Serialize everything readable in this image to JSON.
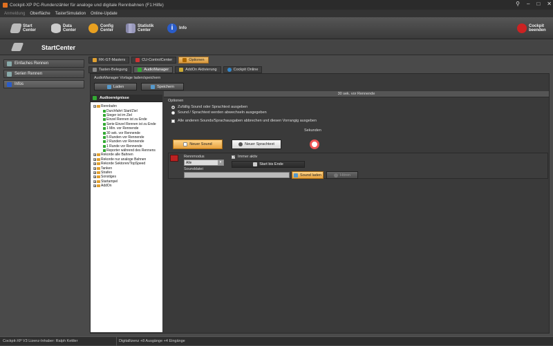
{
  "window": {
    "title": "Cockpit-XP PC-Rundenzähler für analoge und digitale Rennbahnen (F1:Hilfe)"
  },
  "menu": [
    {
      "label": "Anmeldung",
      "disabled": true
    },
    {
      "label": "Oberfläche"
    },
    {
      "label": "TasterSimulation"
    },
    {
      "label": "Online-Update"
    }
  ],
  "toolbar": {
    "start": "Start\nCenter",
    "data": "Data\nCenter",
    "config": "Config\nCenter",
    "stats": "Statistik\nCenter",
    "info": "Info",
    "exit": "Cockpit\nbeenden"
  },
  "header": {
    "title": "StartCenter"
  },
  "sidebar": [
    "Einfaches Rennen",
    "Serien Rennen",
    "Infos"
  ],
  "tabs_top": [
    "RK-GT-Masters",
    "CU-ControlCenter",
    "Optionen"
  ],
  "tabs_sub": [
    "Tasten-Belegung",
    "AudioManager",
    "AddOn Aktivierung",
    "Cockpit Online"
  ],
  "template": {
    "label": "AudioManager Vorlage laden/speichern",
    "load": "Laden",
    "save": "Speichern"
  },
  "selected_item": "30 sek. vor Rennende",
  "tree": {
    "header": "Audioereignisse",
    "items": [
      {
        "label": "Rennbahn",
        "level": 0,
        "type": "folder",
        "exp": "⊟"
      },
      {
        "label": "Durchfahrt Start/Ziel",
        "level": 1,
        "type": "leaf"
      },
      {
        "label": "Sieger ist im Ziel",
        "level": 1,
        "type": "leaf"
      },
      {
        "label": "Einzel Rennen ist zu Ende",
        "level": 1,
        "type": "leaf"
      },
      {
        "label": "Serie Einzel Rennen ist zu Ende",
        "level": 1,
        "type": "leaf"
      },
      {
        "label": "1 Min. vor Rennende",
        "level": 1,
        "type": "leaf"
      },
      {
        "label": "30 sek. vor Rennende",
        "level": 1,
        "type": "leaf"
      },
      {
        "label": "5 Runden vor Rennende",
        "level": 1,
        "type": "leaf"
      },
      {
        "label": "2 Runden vor Rennende",
        "level": 1,
        "type": "leaf"
      },
      {
        "label": "1 Runde vor Rennende",
        "level": 1,
        "type": "leaf"
      },
      {
        "label": "Reporter während des Rennens",
        "level": 1,
        "type": "leaf"
      },
      {
        "label": "Rekorde alle Bahnen",
        "level": 0,
        "type": "folder",
        "exp": "⊞"
      },
      {
        "label": "Rekorde nur analoge Bahnen",
        "level": 0,
        "type": "folder",
        "exp": "⊞"
      },
      {
        "label": "Rekorde Sektoren/TopSpeed",
        "level": 0,
        "type": "folder",
        "exp": "⊞"
      },
      {
        "label": "Tanken",
        "level": 0,
        "type": "folder",
        "exp": "⊞"
      },
      {
        "label": "Strafen",
        "level": 0,
        "type": "folder",
        "exp": "⊞"
      },
      {
        "label": "Sonstiges",
        "level": 0,
        "type": "folder",
        "exp": "⊞"
      },
      {
        "label": "Startampel",
        "level": 0,
        "type": "folder",
        "exp": "⊞"
      },
      {
        "label": "AddOn",
        "level": 0,
        "type": "folder",
        "exp": "⊞"
      }
    ]
  },
  "options": {
    "label": "Optionen",
    "radio1": "Zufällig Sound oder Sprachtext ausgeben",
    "radio2": "Sound / Sprachtext werden abwechseln ausgegeben",
    "check": "Alle anderen Sounds/Sprachausgaben abbrechen und diesen Vorrangig ausgeben",
    "seconds": "Sekunden"
  },
  "actions": {
    "new_sound": "Neuer Sound",
    "new_speech": "Neuer Sprachtext"
  },
  "entry": {
    "mode_label": "Rennmodus",
    "mode_value": "Alle",
    "always_active": "Immer aktiv",
    "start_end": "Start bis Ende",
    "file_label": "Sounddatei",
    "load_sound": "Sound laden",
    "listen": "Hören"
  },
  "status": {
    "left": "Cockpit-XP V3 Lizenz-Inhaber: Ralph Kettler",
    "right": "Digitallizenz  +8 Ausgänge +4 Eingänge"
  }
}
